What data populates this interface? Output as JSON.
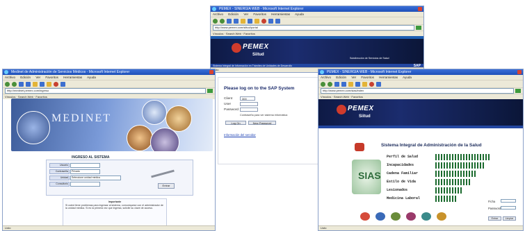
{
  "top_window": {
    "title": "PEMEX - SINERGIA WEB - Microsoft Internet Explorer",
    "menu": [
      "Archivo",
      "Edición",
      "Ver",
      "Favoritos",
      "Herramientas",
      "Ayuda"
    ],
    "address": "http://www.pemex.com/siitud/portal",
    "links": "Vínculos  ·  Search Web  ·  Favoritos",
    "brand": "PEMEX",
    "app": "Siitud",
    "subtitle": "Subdirección de Servicios de Salud",
    "band": "Sistema Integral de Información en Trámites de Unidades de Desarrollo",
    "sap": "SAP",
    "status": "Listo"
  },
  "left_window": {
    "title": "Medinet de Administración de Servicios Médicos - Microsoft Internet Explorer",
    "menu": [
      "Archivo",
      "Edición",
      "Ver",
      "Favoritos",
      "Herramientas",
      "Ayuda"
    ],
    "address": "http://medinet.pemex.com/ingreso",
    "links": "Vínculos  ·  Search Web  ·  Favoritos",
    "banner_title": "MEDINET",
    "form_header": "INGRESO AL SISTEMA",
    "fields": [
      {
        "label": "Usuario",
        "value": ""
      },
      {
        "label": "Contraseña",
        "value": "Privado"
      },
      {
        "label": "Unidad",
        "value": "Seleccione unidad médica"
      },
      {
        "label": "Consultorio",
        "value": ""
      }
    ],
    "enter_label": "Entrar",
    "info_title": "Importante",
    "info_text": "Si usted tiene problemas para ingresar al sistema, comuníquese con el administrador de la unidad médica. Si es la primera vez que ingresa, solicite su clave de acceso.",
    "status": "Listo"
  },
  "sap_panel": {
    "title": "Please log on to the SAP System",
    "client_label": "Client",
    "client_value": "300",
    "user_label": "User",
    "password_label": "Password",
    "change_label": "Contraseña para ver sistema informática",
    "logon_button": "Log On",
    "newpass_button": "New Password",
    "link": "Información del servidor"
  },
  "right_window": {
    "title": "PEMEX - SINERGIA WEB - Microsoft Internet Explorer",
    "menu": [
      "Archivo",
      "Edición",
      "Ver",
      "Favoritos",
      "Herramientas",
      "Ayuda"
    ],
    "address": "http://www.pemex.com/sias/index",
    "links": "Vínculos  ·  Search Web  ·  Favoritos",
    "brand": "PEMEX",
    "app": "Siitud",
    "header": "Sistema Integral de Administración de la Salud",
    "logo_text": "SIAS",
    "menu_items": [
      "Perfil de Salud",
      "Incapacidades",
      "Cadena Familiar",
      "Estilo de Vida",
      "Lesionados",
      "Medicina Laboral"
    ],
    "user_label": "Ficha",
    "pass_label": "Password",
    "enter_button": "Entrar",
    "clear_button": "Limpiar",
    "status": "Listo"
  }
}
